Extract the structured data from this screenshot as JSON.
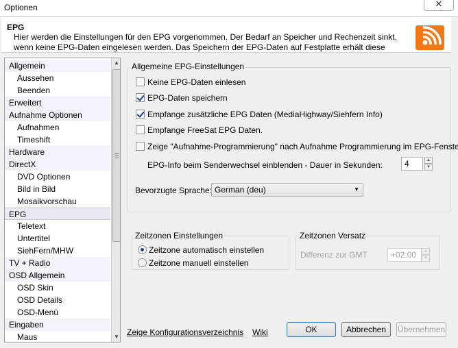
{
  "window": {
    "title": "Optionen",
    "close_glyph": "✕"
  },
  "header": {
    "title": "EPG",
    "description": "Hier werden die Einstellungen für den EPG vorgenommen. Der Bedarf an Speicher und Rechenzeit sinkt, wenn keine EPG-Daten eingelesen werden. Das Speichern der EPG-Daten auf Festplatte erhält diese über das",
    "icon": "rss-icon",
    "accent": "#f07a1a"
  },
  "sidebar": {
    "items": [
      {
        "label": "Allgemein",
        "kind": "group"
      },
      {
        "label": "Aussehen",
        "kind": "child"
      },
      {
        "label": "Beenden",
        "kind": "child"
      },
      {
        "label": "Erweitert",
        "kind": "group"
      },
      {
        "label": "Aufnahme Optionen",
        "kind": "group"
      },
      {
        "label": "Aufnahmen",
        "kind": "child"
      },
      {
        "label": "Timeshift",
        "kind": "child"
      },
      {
        "label": "Hardware",
        "kind": "group"
      },
      {
        "label": "DirectX",
        "kind": "group"
      },
      {
        "label": "DVD Optionen",
        "kind": "child"
      },
      {
        "label": "Bild in Bild",
        "kind": "child"
      },
      {
        "label": "Mosaikvorschau",
        "kind": "child"
      },
      {
        "label": "EPG",
        "kind": "group",
        "selected": true
      },
      {
        "label": "Teletext",
        "kind": "child"
      },
      {
        "label": "Untertitel",
        "kind": "child"
      },
      {
        "label": "SiehFern/MHW",
        "kind": "child"
      },
      {
        "label": "TV + Radio",
        "kind": "group"
      },
      {
        "label": "OSD Allgemein",
        "kind": "group"
      },
      {
        "label": "OSD Skin",
        "kind": "child"
      },
      {
        "label": "OSD Details",
        "kind": "child"
      },
      {
        "label": "OSD-Menü",
        "kind": "child"
      },
      {
        "label": "Eingaben",
        "kind": "group"
      },
      {
        "label": "Maus",
        "kind": "child"
      }
    ]
  },
  "epg_general": {
    "group_title": "Allgemeine EPG-Einstellungen",
    "options": [
      {
        "label": "Keine EPG-Daten einlesen",
        "checked": false
      },
      {
        "label": "EPG-Daten speichern",
        "checked": true
      },
      {
        "label": "Empfange zusätzliche EPG Daten (MediaHighway/Siehfern Info)",
        "checked": true
      },
      {
        "label": "Empfange FreeSat EPG Daten.",
        "checked": false
      },
      {
        "label": "Zeige \"Aufnahme-Programmierung\" nach Aufnahme Programmierung im EPG-Fenster",
        "checked": false
      }
    ],
    "channel_change_label": "EPG-Info beim Senderwechsel einblenden - Dauer in Sekunden:",
    "channel_change_value": "4",
    "language_label": "Bevorzugte Sprache:",
    "language_value": "German (deu)"
  },
  "timezone": {
    "group_title": "Zeitzonen Einstellungen",
    "auto_label": "Zeitzone automatisch einstellen",
    "manual_label": "Zeitzone manuell einstellen",
    "selected": "auto"
  },
  "offset": {
    "group_title": "Zeitzonen Versatz",
    "label": "Differenz zur GMT",
    "value": "+02:00"
  },
  "footer": {
    "config_link": "Zeige Konfigurationsverzeichnis",
    "wiki_link": "Wiki",
    "ok": "OK",
    "cancel": "Abbrechen",
    "apply": "Übernehmen"
  }
}
